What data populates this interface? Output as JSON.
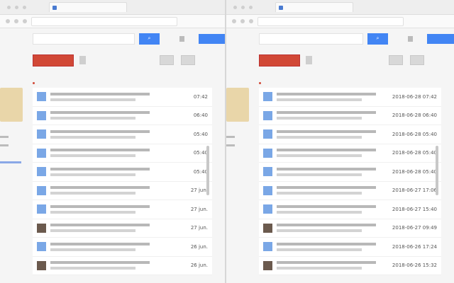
{
  "left_panel": {
    "times": [
      "07:42",
      "06:40",
      "05:40",
      "05:40",
      "05:40",
      "27 jun.",
      "27 jun.",
      "27 jun.",
      "26 jun.",
      "26 jun."
    ]
  },
  "right_panel": {
    "times": [
      "2018-06-28 07:42",
      "2018-06-28 06:40",
      "2018-06-28 05:40",
      "2018-06-28 05:40",
      "2018-06-28 05:40",
      "2018-06-27 17:06",
      "2018-06-27 15:40",
      "2018-06-27 09:49",
      "2018-06-26 17:24",
      "2018-06-26 15:32"
    ]
  },
  "colors": {
    "accent": "#4285f4",
    "compose": "#d14836"
  }
}
